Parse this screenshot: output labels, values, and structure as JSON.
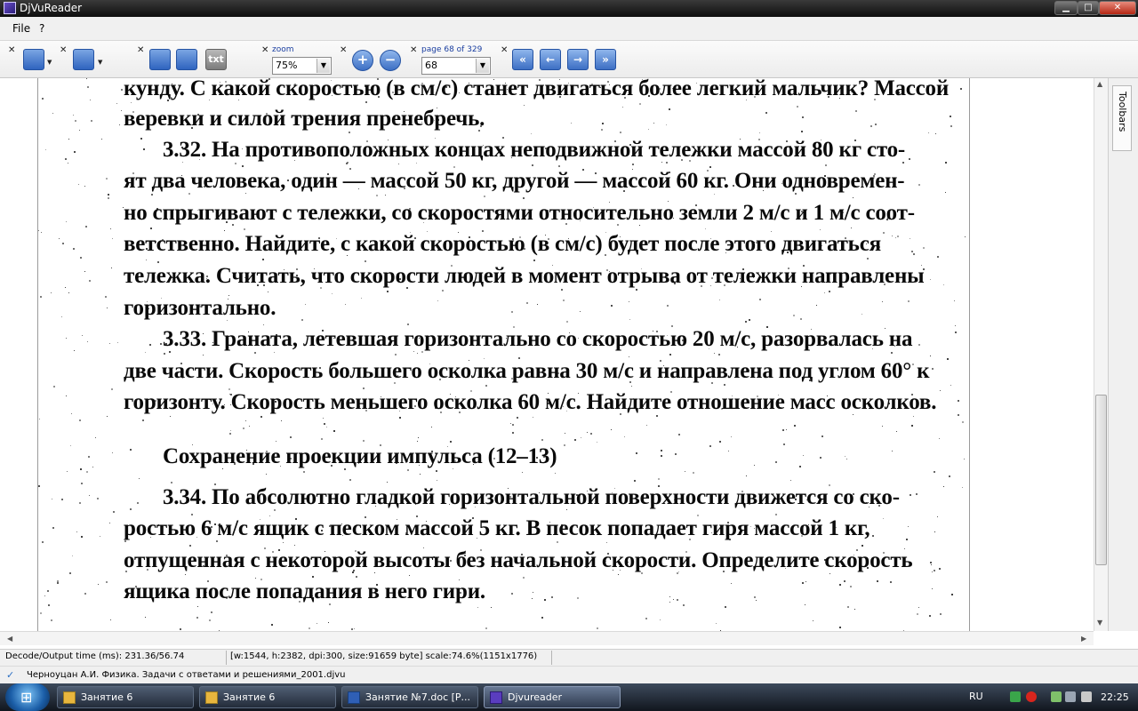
{
  "window": {
    "title": "DjVuReader"
  },
  "menu": {
    "items": [
      "File",
      "?"
    ]
  },
  "toolbar": {
    "zoom_label": "zoom",
    "zoom_value": "75%",
    "page_label": "page 68 of 329",
    "page_value": "68",
    "text_button": "txt"
  },
  "side_panel": {
    "tab_label": "Toolbars"
  },
  "document": {
    "lines": [
      "кунду. С какой скоростью (в см/с) станет двигаться более легкий мальчик? Массой",
      "веревки и силой трения пренебречь.",
      "3.32. На противоположных концах неподвижной тележки массой 80 кг сто-",
      "ят два человека, один — массой 50 кг, другой — массой 60 кг. Они одновремен-",
      "но спрыгивают с тележки, со скоростями относительно земли 2 м/с и 1 м/с соот-",
      "ветственно. Найдите, с какой скоростью (в см/с) будет после этого двигаться",
      "тележка. Считать, что скорости людей в момент отрыва от тележки направлены",
      "горизонтально.",
      "3.33. Граната, летевшая горизонтально со скоростью 20 м/с, разорвалась на",
      "две части. Скорость большего осколка равна 30 м/с и направлена под углом 60° к",
      "горизонту. Скорость меньшего осколка 60 м/с. Найдите отношение масс осколков.",
      "Сохранение проекции импульса (12–13)",
      "3.34. По абсолютно гладкой горизонтальной поверхности движется со ско-",
      "ростью 6 м/с ящик с песком массой 5 кг. В песок попадает гиря массой 1 кг,",
      "отпущенная с некоторой высоты без начальной скорости. Определите скорость",
      "ящика после попадания в него гири."
    ]
  },
  "status": {
    "decode_time": "Decode/Output time (ms): 231.36/56.74",
    "image_info": "[w:1544, h:2382, dpi:300, size:91659 byte] scale:74.6%(1151x1776)"
  },
  "file": {
    "name": "Черноуцан А.И. Физика. Задачи с ответами и решениями_2001.djvu"
  },
  "taskbar": {
    "tasks": [
      "Занятие 6",
      "Занятие 6",
      "Занятие №7.doc [Р...",
      "Djvureader"
    ],
    "language": "RU",
    "clock": "22:25"
  }
}
